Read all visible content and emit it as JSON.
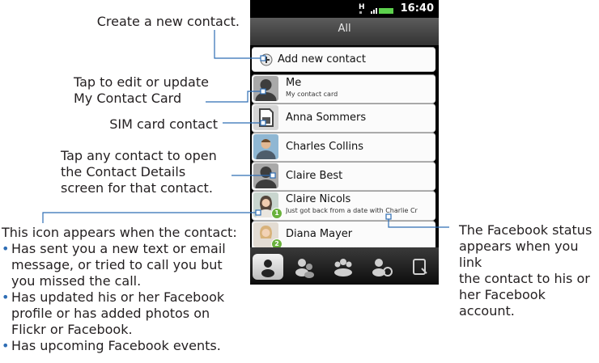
{
  "phone": {
    "status_bar": {
      "network": "H",
      "time": "16:40"
    },
    "title": "All",
    "add_contact_label": "Add new contact",
    "contacts": [
      {
        "name": "Me",
        "subtitle": "My contact card",
        "type": "me"
      },
      {
        "name": "Anna Sommers",
        "type": "sim"
      },
      {
        "name": "Charles Collins",
        "type": "photo"
      },
      {
        "name": "Claire Best",
        "type": "silhouette"
      },
      {
        "name": "Claire Nicols",
        "subtitle": "Just got back from a date with Charlie Cr",
        "type": "photo",
        "badge": "1"
      },
      {
        "name": "Diana Mayer",
        "type": "photo",
        "badge": "2"
      }
    ],
    "tabs": [
      "person-icon",
      "group-people-icon",
      "groups-icon",
      "call-history-icon",
      "updates-icon"
    ]
  },
  "callouts": {
    "create": "Create a new contact.",
    "edit_line1": "Tap to edit or update",
    "edit_line2": "My Contact Card",
    "sim": "SIM card contact",
    "tap_line1": "Tap any contact to open",
    "tap_line2": "the Contact Details",
    "tap_line3": "screen for that contact.",
    "icon_intro": "This icon appears when the contact:",
    "icon_bullets": [
      "Has sent you a new text or email message, or tried to call you but you missed the call.",
      "Has updated his or her Facebook profile or has added photos on Flickr or Facebook.",
      "Has upcoming Facebook events."
    ],
    "fb_line1": "The Facebook status",
    "fb_line2": "appears when you link",
    "fb_line3": "the contact to his or",
    "fb_line4": "her Facebook account."
  }
}
